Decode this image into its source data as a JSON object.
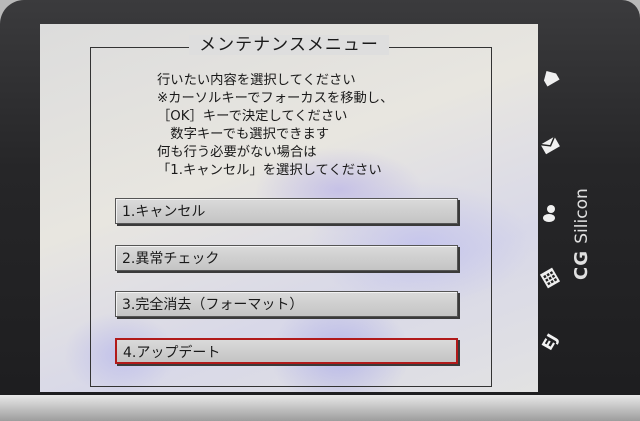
{
  "screen": {
    "title": "メンテナンスメニュー",
    "instructions": [
      "行いたい内容を選択してください",
      "※カーソルキーでフォーカスを移動し、",
      "［OK］キーで決定してください",
      "　数字キーでも選択できます",
      "何も行う必要がない場合は",
      "「1.キャンセル」を選択してください"
    ],
    "menu": [
      {
        "label": "1.キャンセル",
        "focused": false
      },
      {
        "label": "2.異常チェック",
        "focused": false
      },
      {
        "label": "3.完全消去（フォーマット）",
        "focused": false
      },
      {
        "label": "4.アップデート",
        "focused": true
      }
    ]
  },
  "side_buttons": [
    {
      "icon": "home-icon"
    },
    {
      "icon": "mail-icon"
    },
    {
      "icon": "contacts-icon"
    },
    {
      "icon": "calculator-icon"
    },
    {
      "icon": "language-ej-icon",
      "label": "EJ"
    }
  ],
  "brand": {
    "mark": "CG",
    "name": "Silicon"
  },
  "colors": {
    "focus_border": "#b11a1a",
    "bezel": "#262628"
  }
}
